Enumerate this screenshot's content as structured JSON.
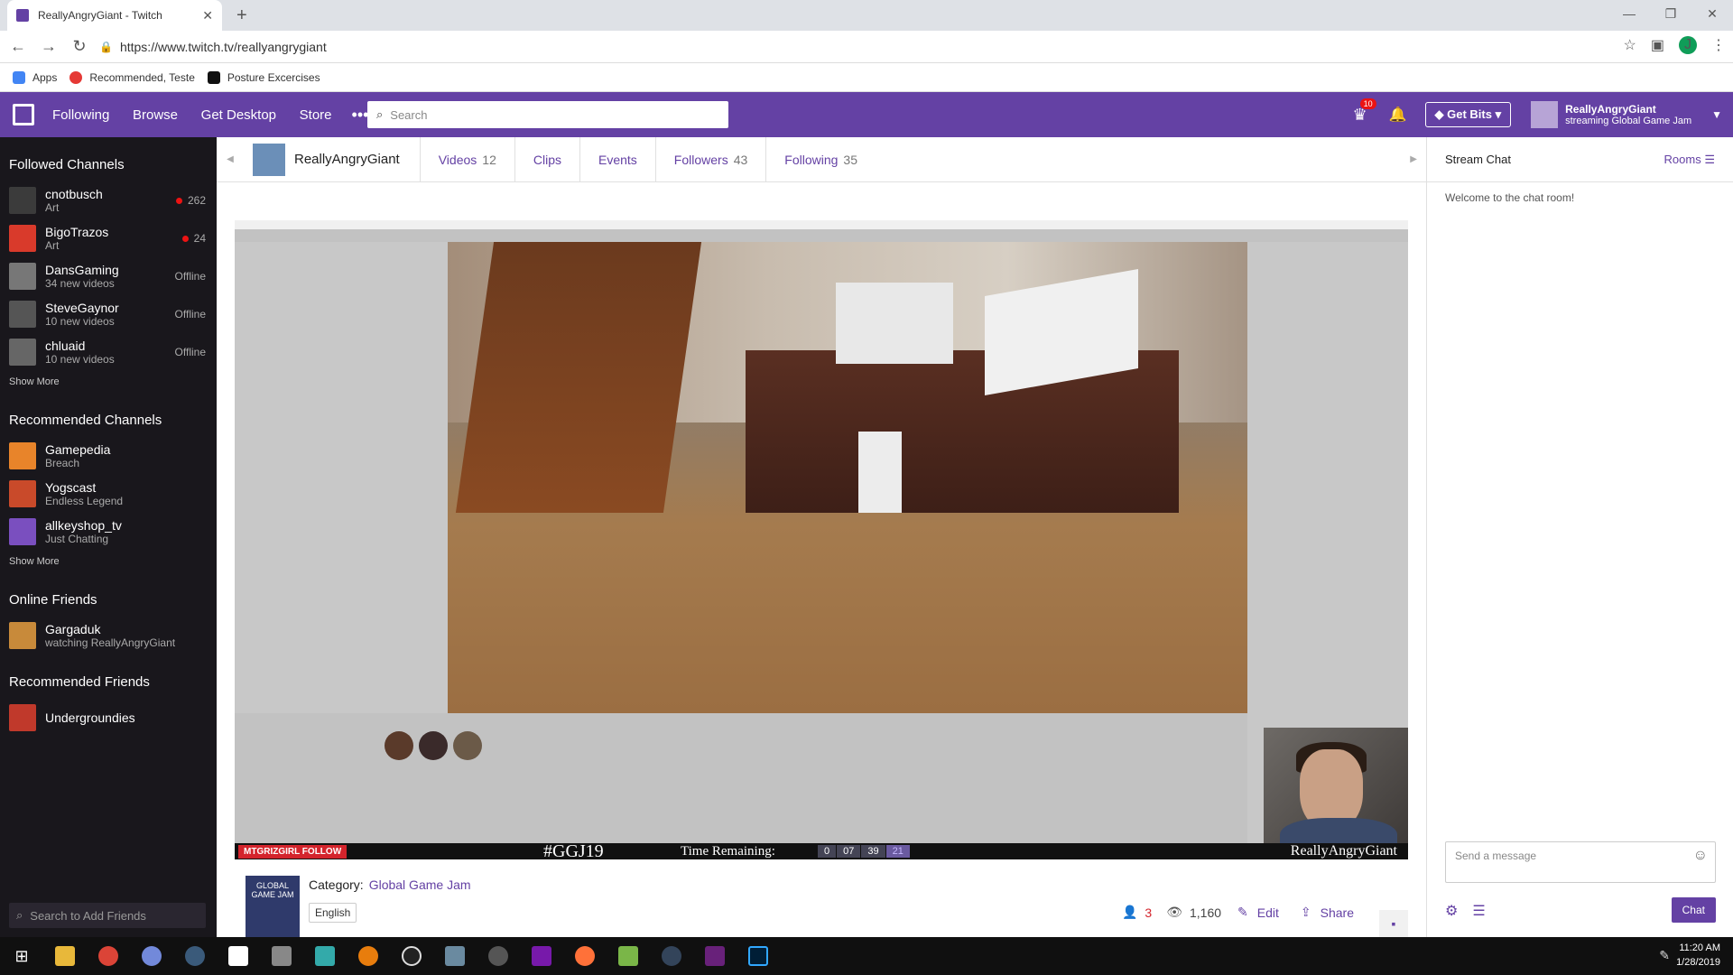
{
  "browser": {
    "tab_title": "ReallyAngryGiant - Twitch",
    "url": "https://www.twitch.tv/reallyangrygiant",
    "bookmarks": [
      "Apps",
      "Recommended, Teste",
      "Posture Excercises"
    ],
    "profile_initial": "J"
  },
  "topnav": {
    "items": [
      "Following",
      "Browse",
      "Get Desktop",
      "Store"
    ],
    "search_placeholder": "Search",
    "notif_count": "10",
    "get_bits": "Get Bits",
    "user_name": "ReallyAngryGiant",
    "user_status": "streaming Global Game Jam"
  },
  "sidebar": {
    "followed_title": "Followed Channels",
    "followed": [
      {
        "name": "cnotbusch",
        "sub": "Art",
        "stat": "262",
        "live": true,
        "color": "#3b3b3b"
      },
      {
        "name": "BigoTrazos",
        "sub": "Art",
        "stat": "24",
        "live": true,
        "color": "#d93a2b"
      },
      {
        "name": "DansGaming",
        "sub": "34 new videos",
        "stat": "Offline",
        "live": false,
        "color": "#777777"
      },
      {
        "name": "SteveGaynor",
        "sub": "10 new videos",
        "stat": "Offline",
        "live": false,
        "color": "#555555"
      },
      {
        "name": "chluaid",
        "sub": "10 new videos",
        "stat": "Offline",
        "live": false,
        "color": "#666666"
      }
    ],
    "show_more": "Show More",
    "recommended_title": "Recommended Channels",
    "recommended": [
      {
        "name": "Gamepedia",
        "sub": "Breach",
        "color": "#e8842a"
      },
      {
        "name": "Yogscast",
        "sub": "Endless Legend",
        "color": "#c94a2a"
      },
      {
        "name": "allkeyshop_tv",
        "sub": "Just Chatting",
        "color": "#7a4fbf"
      }
    ],
    "online_title": "Online Friends",
    "friends": [
      {
        "name": "Gargaduk",
        "sub": "watching ReallyAngryGiant",
        "color": "#c88a3a"
      }
    ],
    "rec_friends_title": "Recommended Friends",
    "rec_friends": [
      {
        "name": "Undergroundies",
        "color": "#c0392b"
      }
    ],
    "friend_search_placeholder": "Search to Add Friends"
  },
  "channel": {
    "name": "ReallyAngryGiant",
    "tabs": [
      {
        "label": "Videos",
        "count": "12"
      },
      {
        "label": "Clips",
        "count": ""
      },
      {
        "label": "Events",
        "count": ""
      },
      {
        "label": "Followers",
        "count": "43"
      },
      {
        "label": "Following",
        "count": "35"
      }
    ]
  },
  "overlay": {
    "follow": "MTGRIZGIRL FOLLOW",
    "hashtag": "#GGJ19",
    "time_label": "Time Remaining:",
    "counter": [
      "0",
      "07",
      "39",
      "21"
    ],
    "name": "ReallyAngryGiant"
  },
  "info": {
    "box_text": "GLOBAL GAME JAM",
    "category_label": "Category:",
    "category": "Global Game Jam",
    "language": "English",
    "viewers_live": "3",
    "views": "1,160",
    "edit": "Edit",
    "share": "Share"
  },
  "chat": {
    "title": "Stream Chat",
    "rooms": "Rooms",
    "welcome": "Welcome to the chat room!",
    "placeholder": "Send a message",
    "chat_button": "Chat"
  },
  "taskbar": {
    "time": "11:20 AM",
    "date": "1/28/2019"
  }
}
